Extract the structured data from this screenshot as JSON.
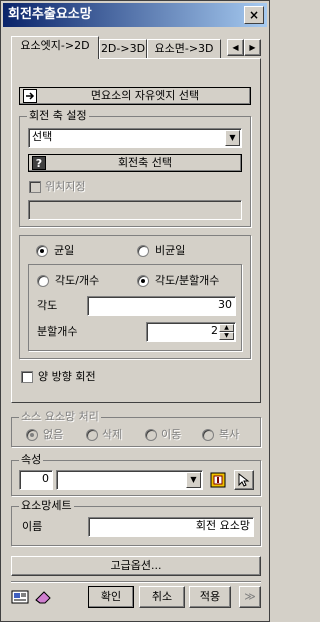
{
  "window": {
    "title": "회전추출요소망",
    "close_label": "×"
  },
  "tabs": [
    {
      "label": "요소엣지->2D"
    },
    {
      "label": "2D->3D"
    },
    {
      "label": "요소면->3D"
    }
  ],
  "tab_scroll": {
    "left": "◀",
    "right": "▶"
  },
  "tab_content": {
    "select_free_edge_button": "면요소의 자유엣지 선택",
    "axis_group": {
      "title": "회전 축 설정",
      "dropdown_value": "선택",
      "select_axis_button": "회전축 선택",
      "position_check_label": "위치지정",
      "position_value": ""
    },
    "uniform_group": {
      "uniform_label": "균일",
      "nonuniform_label": "비균일",
      "mode_group": {
        "angle_count_label": "각도/개수",
        "angle_div_label": "각도/분할개수",
        "angle_label": "각도",
        "angle_value": "30",
        "div_label": "분할개수",
        "div_value": "2"
      }
    },
    "both_dir_label": "양 방향 회전"
  },
  "source_group": {
    "title": "소스 요소망 처리",
    "options": [
      "없음",
      "삭제",
      "이동",
      "복사"
    ]
  },
  "attr_group": {
    "title": "속성",
    "id_value": "0",
    "combo_value": ""
  },
  "mesh_group": {
    "title": "요소망세트",
    "name_label": "이름",
    "name_value": "회전 요소망"
  },
  "advanced_button": "고급옵션...",
  "bottom": {
    "ok_label": "확인",
    "cancel_label": "취소",
    "apply_label": "적용",
    "expand_label": "≫"
  }
}
